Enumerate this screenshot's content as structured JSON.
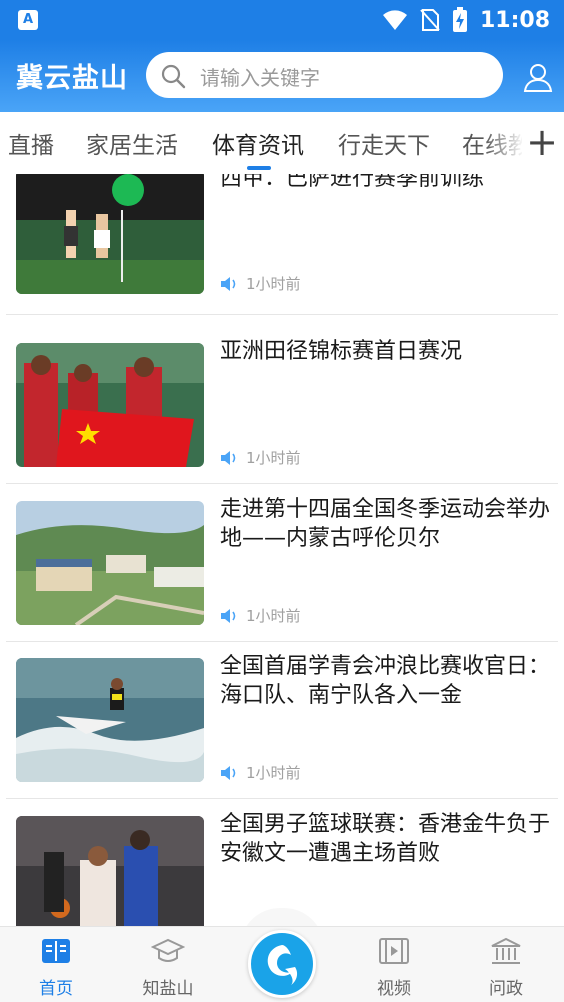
{
  "status": {
    "time": "11:08"
  },
  "header": {
    "brand": "冀云盐山",
    "search_placeholder": "请输入关键字"
  },
  "tabs": [
    {
      "label": "直播",
      "active": false
    },
    {
      "label": "家居生活",
      "active": false
    },
    {
      "label": "体育资讯",
      "active": true
    },
    {
      "label": "行走天下",
      "active": false
    },
    {
      "label": "在线教",
      "active": false
    }
  ],
  "tab_plus": "+",
  "news": [
    {
      "title": "西甲：巴萨进行赛季前训练",
      "time": "1小时前"
    },
    {
      "title": "亚洲田径锦标赛首日赛况",
      "time": "1小时前"
    },
    {
      "title": "走进第十四届全国冬季运动会举办地——内蒙古呼伦贝尔",
      "time": "1小时前"
    },
    {
      "title": "全国首届学青会冲浪比赛收官日：海口队、南宁队各入一金",
      "time": "1小时前"
    },
    {
      "title": "全国男子篮球联赛：香港金牛负于安徽文一遭遇主场首败",
      "time": ""
    }
  ],
  "bottom_nav": [
    {
      "label": "首页",
      "icon": "book-icon",
      "active": true
    },
    {
      "label": "知盐山",
      "icon": "graduation-cap-icon",
      "active": false
    },
    {
      "label": "视频",
      "icon": "film-icon",
      "active": false
    },
    {
      "label": "问政",
      "icon": "government-building-icon",
      "active": false
    }
  ],
  "colors": {
    "primary": "#1e7fe6",
    "center_button": "#1aa3e8"
  }
}
